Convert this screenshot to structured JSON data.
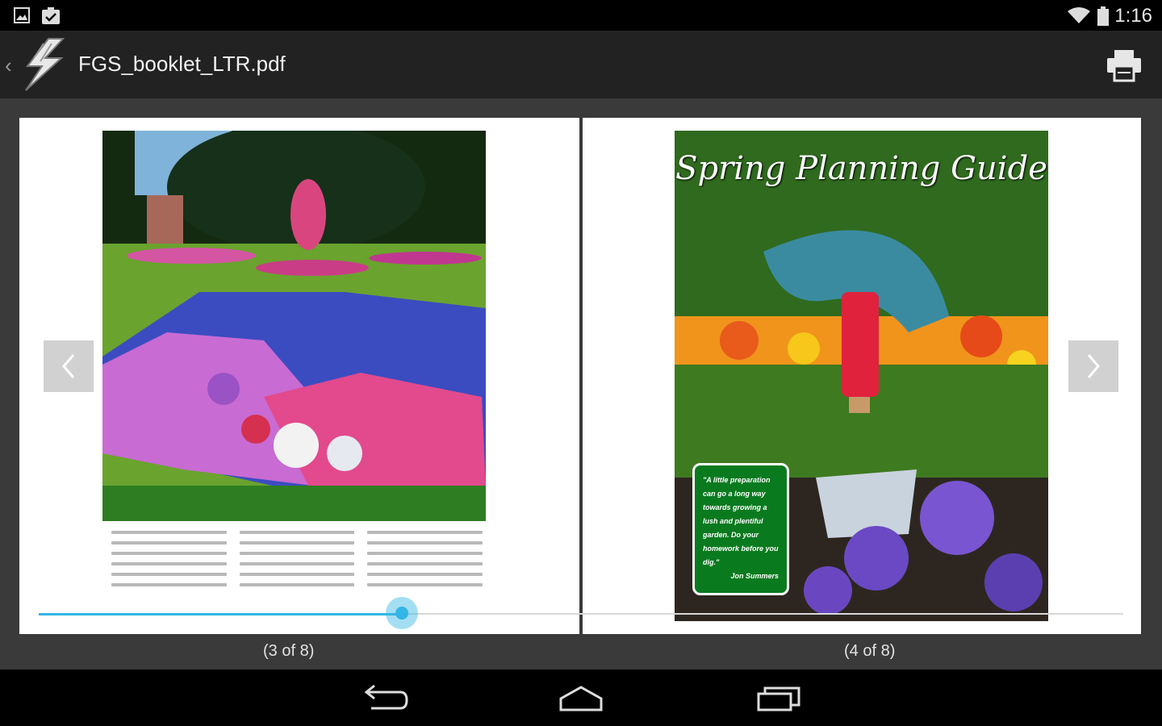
{
  "status_bar": {
    "time": "1:16",
    "icons": [
      "image-notification-icon",
      "clipboard-check-icon",
      "wifi-icon",
      "battery-icon"
    ]
  },
  "action_bar": {
    "title": "FGS_booklet_LTR.pdf",
    "icons": [
      "back-chevron-icon",
      "lightning-logo-icon",
      "print-icon"
    ]
  },
  "document": {
    "left_page": {
      "label": "(3 of 8)"
    },
    "right_page": {
      "label": "(4 of 8)",
      "title": "Spring Planning Guide",
      "quote": "\"A little preparation can go a long way towards growing a lush and plentiful garden. Do your homework before you dig.\"",
      "quote_author": "Jon Summers"
    },
    "progress_fraction": 0.335
  },
  "nav_bar": {
    "icons": [
      "back-icon",
      "home-icon",
      "recent-apps-icon"
    ]
  },
  "colors": {
    "accent": "#33b5e5",
    "action_bar_bg": "#222222",
    "viewer_bg": "#3a3a3a",
    "quote_bg": "#0a7a1f"
  }
}
